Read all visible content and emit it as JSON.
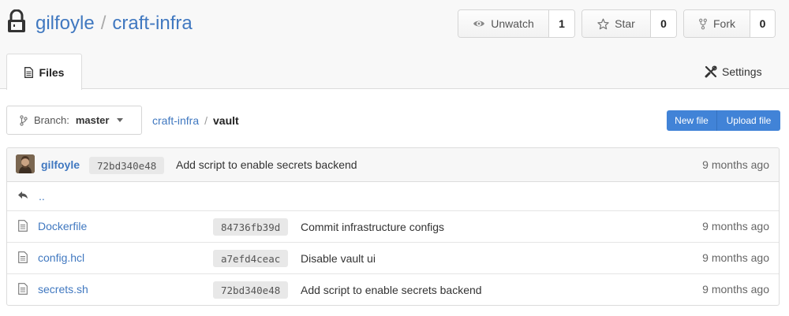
{
  "repo": {
    "owner": "gilfoyle",
    "separator": "/",
    "name": "craft-infra"
  },
  "actions": {
    "watch": {
      "label": "Unwatch",
      "count": "1"
    },
    "star": {
      "label": "Star",
      "count": "0"
    },
    "fork": {
      "label": "Fork",
      "count": "0"
    }
  },
  "tabs": {
    "files": "Files",
    "settings": "Settings"
  },
  "branch": {
    "prefix": "Branch:",
    "name": "master"
  },
  "breadcrumb": {
    "root": "craft-infra",
    "separator": "/",
    "current": "vault"
  },
  "buttons": {
    "new_file": "New file",
    "upload_file": "Upload file"
  },
  "latest_commit": {
    "author": "gilfoyle",
    "sha": "72bd340e48",
    "message": "Add script to enable secrets backend",
    "time": "9 months ago"
  },
  "parent_dir": "..",
  "files": [
    {
      "name": "Dockerfile",
      "sha": "84736fb39d",
      "message": "Commit infrastructure configs",
      "time": "9 months ago"
    },
    {
      "name": "config.hcl",
      "sha": "a7efd4ceac",
      "message": "Disable vault ui",
      "time": "9 months ago"
    },
    {
      "name": "secrets.sh",
      "sha": "72bd340e48",
      "message": "Add script to enable secrets backend",
      "time": "9 months ago"
    }
  ],
  "colors": {
    "link": "#4078c0",
    "primary_button": "#4183d7",
    "header_bg": "#f8f8f8"
  }
}
